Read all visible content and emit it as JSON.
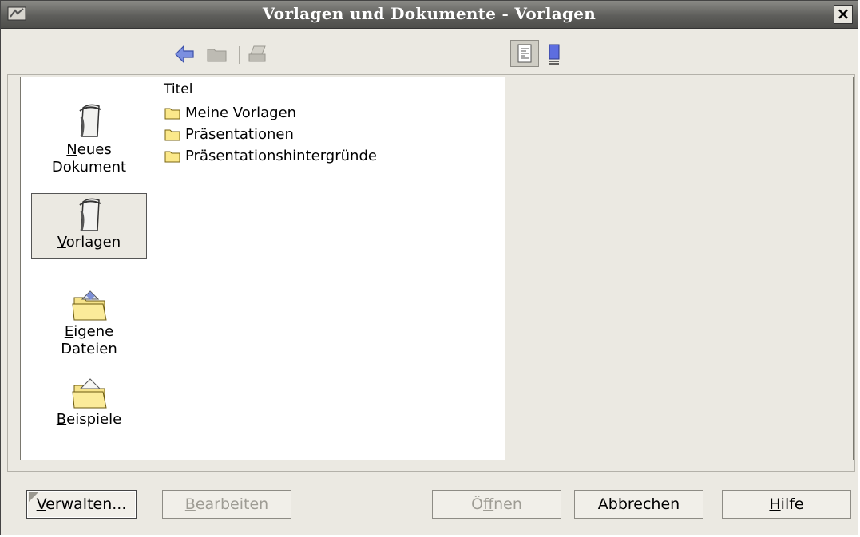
{
  "window": {
    "title": "Vorlagen und Dokumente - Vorlagen",
    "close_glyph": "×"
  },
  "toolbar": {
    "back_icon": "back-arrow-icon",
    "up_icon": "folder-up-icon",
    "print_icon": "print-icon",
    "document_view_icon": "document-view-icon",
    "preview_view_icon": "preview-view-icon"
  },
  "nav": {
    "items": [
      {
        "label_accel": "N",
        "label_rest": "eues",
        "label_line2": "Dokument",
        "icon": "new-document-icon"
      },
      {
        "label_accel": "V",
        "label_rest": "orlagen",
        "label_line2": "",
        "icon": "templates-icon",
        "selected": true
      },
      {
        "label_accel": "E",
        "label_rest": "igene",
        "label_line2": "Dateien",
        "icon": "my-documents-folder-icon"
      },
      {
        "label_accel": "B",
        "label_rest": "eispiele",
        "label_line2": "",
        "icon": "samples-folder-icon"
      }
    ]
  },
  "list": {
    "column_header": "Titel",
    "rows": [
      {
        "label": "Meine Vorlagen",
        "icon": "folder-icon"
      },
      {
        "label": "Präsentationen",
        "icon": "folder-icon"
      },
      {
        "label": "Präsentationshintergründe",
        "icon": "folder-icon"
      }
    ]
  },
  "buttons": {
    "manage": {
      "accel": "V",
      "rest": "erwalten..."
    },
    "edit": {
      "accel": "B",
      "rest": "earbeiten"
    },
    "open": {
      "pre": "Ö",
      "accel": "f",
      "rest": "fnen"
    },
    "cancel": {
      "label": "Abbrechen"
    },
    "help": {
      "accel": "H",
      "rest": "ilfe"
    }
  }
}
